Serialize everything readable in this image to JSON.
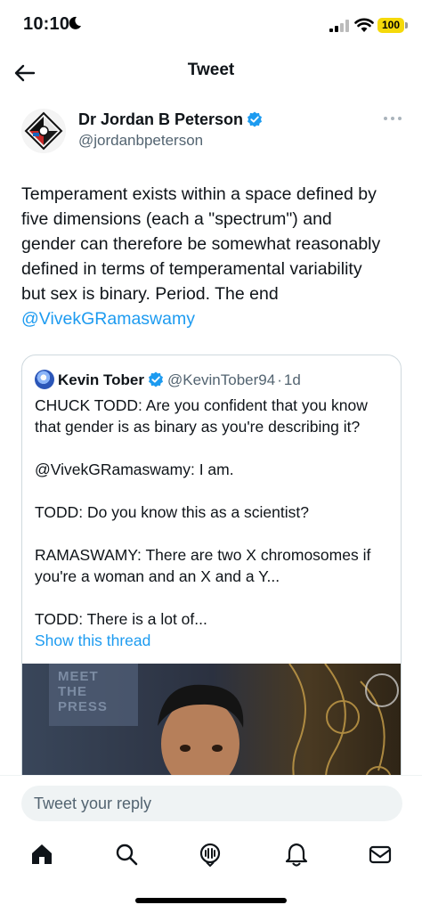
{
  "status_bar": {
    "time": "10:10",
    "battery": "100"
  },
  "header": {
    "title": "Tweet"
  },
  "tweet": {
    "author_name": "Dr Jordan B Peterson",
    "author_handle": "@jordanbpeterson",
    "lines": [
      "Temperament exists within a space defined by",
      "five dimensions (each a \"spectrum\") and",
      "gender can therefore be somewhat reasonably",
      "defined in terms of  temperamental variability",
      "but sex is binary. Period. The end"
    ],
    "mention": "@VivekGRamaswamy"
  },
  "quote": {
    "author_name": "Kevin Tober",
    "author_handle": "@KevinTober94",
    "separator": "·",
    "time_ago": "1d",
    "lines": [
      "CHUCK TODD: Are you confident that you know",
      "that gender is as binary as you're describing it?",
      "",
      "@VivekGRamaswamy: I am.",
      "",
      "TODD: Do you know this as a scientist?",
      "",
      "RAMASWAMY: There are two X chromosomes if",
      "you're a woman and an X and a Y...",
      "",
      "TODD: There is a lot of..."
    ],
    "show_thread": "Show this thread",
    "media_sign_text": "MEET THE PRESS"
  },
  "reply": {
    "placeholder": "Tweet your reply"
  },
  "tabs": [
    {
      "icon": "home-icon"
    },
    {
      "icon": "search-icon"
    },
    {
      "icon": "spaces-icon"
    },
    {
      "icon": "notifications-icon"
    },
    {
      "icon": "messages-icon"
    }
  ],
  "colors": {
    "accent": "#1d9bf0",
    "text": "#0f1419",
    "secondary": "#536471",
    "battery": "#f5d90a"
  }
}
